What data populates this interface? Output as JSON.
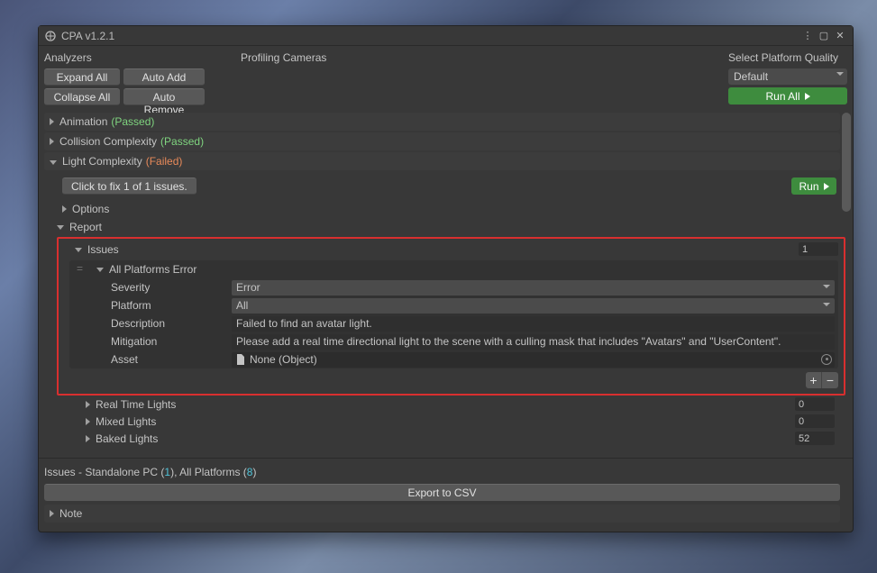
{
  "window": {
    "title": "CPA v1.2.1"
  },
  "toolbar": {
    "analyzers_label": "Analyzers",
    "profiling_label": "Profiling Cameras",
    "expand_all": "Expand All",
    "collapse_all": "Collapse All",
    "auto_add": "Auto Add",
    "auto_remove": "Auto Remove",
    "platform_quality_label": "Select Platform Quality",
    "platform_quality_value": "Default",
    "run_all": "Run All"
  },
  "sections": {
    "animation": {
      "label": "Animation",
      "status": "(Passed)"
    },
    "collision": {
      "label": "Collision Complexity",
      "status": "(Passed)"
    },
    "light": {
      "label": "Light Complexity",
      "status": "(Failed)",
      "fix_button": "Click to fix 1 of 1 issues.",
      "run_label": "Run",
      "options_label": "Options",
      "report_label": "Report",
      "issues_label": "Issues",
      "issues_count": "1",
      "issue": {
        "header": "All Platforms Error",
        "severity_label": "Severity",
        "severity_value": "Error",
        "platform_label": "Platform",
        "platform_value": "All",
        "description_label": "Description",
        "description_value": "Failed to find an avatar light.",
        "mitigation_label": "Mitigation",
        "mitigation_value": "Please add a real time directional light to the scene with a culling mask that includes \"Avatars\" and \"UserContent\".",
        "asset_label": "Asset",
        "asset_value": "None (Object)"
      },
      "realtime_label": "Real Time Lights",
      "realtime_count": "0",
      "mixed_label": "Mixed Lights",
      "mixed_count": "0",
      "baked_label": "Baked Lights",
      "baked_count": "52"
    }
  },
  "footer": {
    "issues_prefix": "Issues - Standalone PC (",
    "issues_pc": "1",
    "issues_mid": "), All Platforms (",
    "issues_all": "8",
    "issues_suffix": ")",
    "export_label": "Export to CSV",
    "note_label": "Note"
  }
}
